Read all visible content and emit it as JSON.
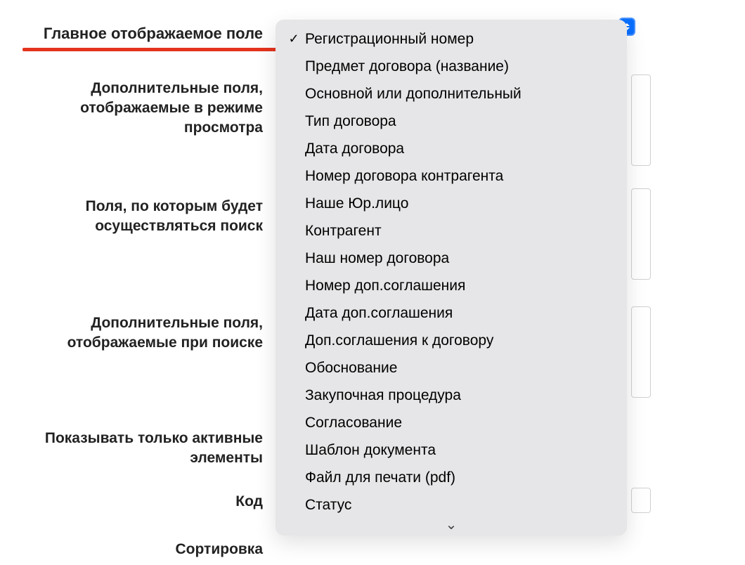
{
  "fields": {
    "main_display": "Главное отображаемое поле",
    "extra_view": "Дополнительные поля, отображаемые в режиме просмотра",
    "search_fields": "Поля, по которым будет осуществляться поиск",
    "extra_search": "Дополнительные поля, отображаемые при поиске",
    "active_only": "Показывать только активные элементы",
    "code": "Код",
    "sorting": "Сортировка"
  },
  "dropdown": {
    "selected": "Регистрационный номер",
    "options": [
      "Регистрационный номер",
      "Предмет договора (название)",
      "Основной или дополнительный",
      "Тип договора",
      "Дата договора",
      "Номер договора контрагента",
      "Наше Юр.лицо",
      "Контрагент",
      "Наш номер договора",
      "Номер доп.соглашения",
      "Дата доп.соглашения",
      "Доп.соглашения к договору",
      "Обоснование",
      "Закупочная процедура",
      "Согласование",
      "Шаблон документа",
      "Файл для печати (pdf)",
      "Статус"
    ]
  },
  "icons": {
    "check": "✓",
    "scroll_down": "⌄"
  }
}
